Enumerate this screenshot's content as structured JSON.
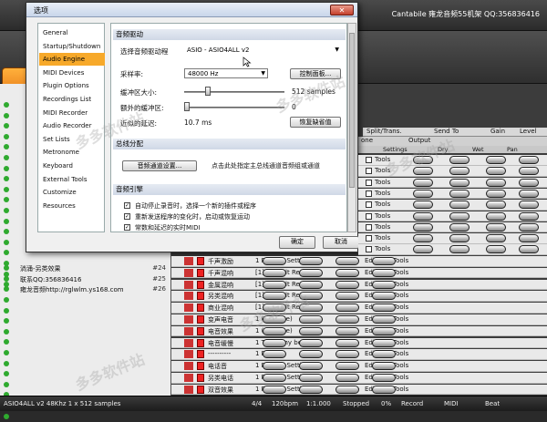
{
  "app": {
    "title": "Cantabile 雍龙音频55机架 QQ:356836416"
  },
  "toolbar": {
    "audio_label": "Audio Opt"
  },
  "dialog": {
    "title": "选项",
    "close": "✕",
    "nav": [
      "General",
      "Startup/Shutdown",
      "Audio Engine",
      "MIDI Devices",
      "Plugin Options",
      "Recordings List",
      "MIDI Recorder",
      "Audio Recorder",
      "Set Lists",
      "Metronome",
      "Keyboard",
      "External Tools",
      "Customize",
      "Resources"
    ],
    "selected_nav": "Audio Engine",
    "audio_driver": {
      "section": "音频驱动",
      "driver_label": "选择音频驱动程",
      "driver_value": "ASIO - ASIO4ALL v2",
      "samplerate_label": "采样率:",
      "samplerate_value": "48000 Hz",
      "control_panel_button": "控制面板...",
      "buffer_label": "缓冲区大小:",
      "buffer_value": "512 samples",
      "buffer_level": 0.22,
      "extra_buffer_label": "额外的缓冲区:",
      "extra_buffer_value": "0",
      "extra_buffer_level": 0.0,
      "latency_label": "近似的延迟:",
      "latency_value": "10.7 ms",
      "restore_button": "恢复缺省值"
    },
    "bus": {
      "section": "总线分配",
      "routing_button": "音频通道设置...",
      "routing_hint": "点击此处指定主总线通道音频组或通道"
    },
    "engine": {
      "section": "音频引擎",
      "options": [
        {
          "checked": true,
          "label": "自动停止录音时，选择一个新的插件或程序"
        },
        {
          "checked": true,
          "label": "重新发送程序的变化时，启动或恢复运动"
        },
        {
          "checked": true,
          "label": "常数和延迟的实时MIDI"
        }
      ]
    },
    "ok": "确定",
    "cancel": "取消"
  },
  "left_list": [
    {
      "name": "淌涌-另类效果",
      "idx": "#24"
    },
    {
      "name": "联系QQ:356836416",
      "idx": "#25"
    },
    {
      "name": "雍龙音频http://rglwlm.ys168.com",
      "idx": "#26"
    }
  ],
  "mixer": {
    "header": [
      "Split/Trans.",
      "Send To",
      "Gain",
      "Level"
    ],
    "sub": [
      "one",
      "Output"
    ],
    "columns": [
      "Settings",
      "Dry",
      "Wet",
      "Pan"
    ],
    "tracks": [
      {
        "name": "千声激励",
        "program": "1 Factory Setting"
      },
      {
        "name": "千声混响",
        "program": "[1] Default Reverb"
      },
      {
        "name": "金属混响",
        "program": "[1] Default Reverb"
      },
      {
        "name": "另类混响",
        "program": "[1] Default Reverb"
      },
      {
        "name": "商业混响",
        "program": "[1] Default Reverb"
      },
      {
        "name": "变声电音",
        "program": "1 (noname)"
      },
      {
        "name": "电音效果",
        "program": "1 (noname)"
      },
      {
        "name": "电音缓慢",
        "program": "1 Tickle my beats"
      },
      {
        "name": "----------",
        "program": "1 Default"
      },
      {
        "name": "电话音",
        "program": "1 Default Setting"
      },
      {
        "name": "另类电话",
        "program": "1 Factory Setting"
      },
      {
        "name": "双音效果",
        "program": "1 Factory Setting"
      }
    ],
    "edit_label": "Edit",
    "tools_label": "Tools"
  },
  "status": {
    "device": "ASIO4ALL v2 48Khz 1 x 512 samples",
    "time_sig": "4/4",
    "tempo": "120bpm",
    "position": "1:1.000",
    "state": "Stopped",
    "cpu": "0%",
    "record": "Record",
    "midi": "MIDI",
    "beat": "Beat"
  },
  "watermark": "多多软件站"
}
